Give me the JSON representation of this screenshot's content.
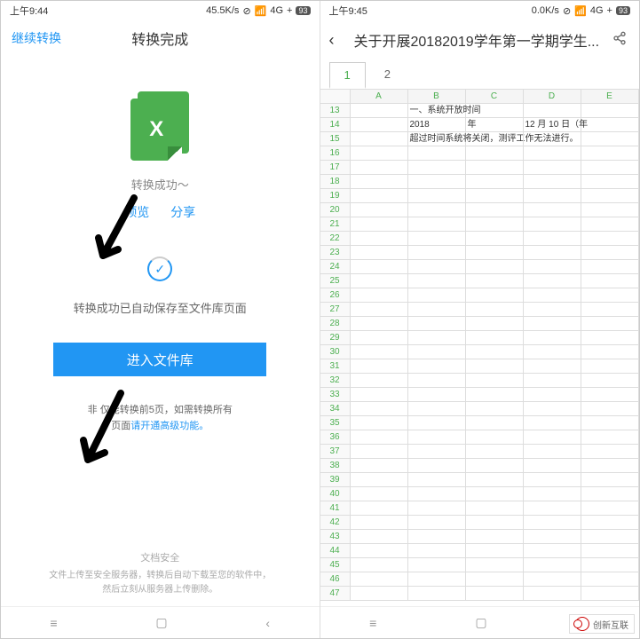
{
  "left_phone": {
    "status": {
      "time": "上午9:44",
      "speed": "45.5K/s",
      "network": "4G",
      "battery": "93"
    },
    "header": {
      "back_link": "继续转换",
      "title": "转换完成"
    },
    "body": {
      "excel_letter": "X",
      "success_text": "转换成功～",
      "preview_link": "预览",
      "share_link": "分享",
      "saved_text": "转换成功已自动保存至文件库页面",
      "enter_btn": "进入文件库",
      "limit_line1": "非       仅能转换前5页，如需转换所有",
      "limit_line2_a": "页面",
      "limit_line2_b": "请开通高级功能。",
      "security_title": "文档安全",
      "security_line1": "文件上传至安全服务器，转换后自动下载至您的软件中，",
      "security_line2": "然后立刻从服务器上传删除。"
    }
  },
  "right_phone": {
    "status": {
      "time": "上午9:45",
      "speed": "0.0K/s",
      "network": "4G",
      "battery": "93"
    },
    "header": {
      "title": "关于开展20182019学年第一学期学生..."
    },
    "sheet": {
      "tabs": [
        "1",
        "2"
      ],
      "active_tab": 0,
      "cols": [
        "A",
        "B",
        "C",
        "D",
        "E"
      ],
      "row_start": 13,
      "row_end": 47,
      "rows": {
        "13": {
          "B": "一、系统开放时间"
        },
        "14": {
          "B": "2018",
          "C": "年",
          "D": "12 月 10 日（年"
        },
        "15": {
          "B": "超过时间系统将关闭，测评工作无法进行。"
        }
      }
    }
  },
  "watermark": "创新互联",
  "nav": {
    "menu": "≡",
    "home": "▢",
    "back": "‹"
  }
}
